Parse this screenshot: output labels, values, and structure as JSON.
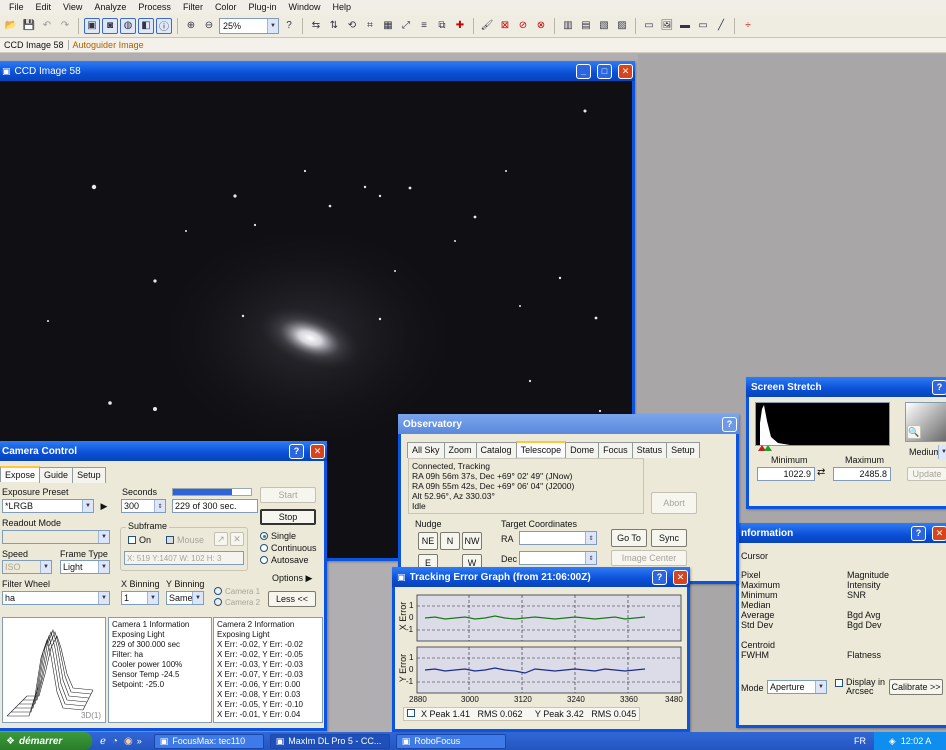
{
  "menu": [
    "File",
    "Edit",
    "View",
    "Analyze",
    "Process",
    "Filter",
    "Color",
    "Plug-in",
    "Window",
    "Help"
  ],
  "toolbar": {
    "zoom": "25%"
  },
  "doc_tabs": [
    "CCD Image 58",
    "Autoguider Image"
  ],
  "ccd": {
    "title": "CCD Image 58"
  },
  "stretch": {
    "title": "Screen Stretch",
    "min_label": "Minimum",
    "min_value": "1022.9",
    "max_label": "Maximum",
    "max_value": "2485.8",
    "mode_value": "Medium",
    "update_label": "Update"
  },
  "info": {
    "title": "nformation",
    "cursor": "Cursor",
    "left": [
      "Pixel",
      "Maximum",
      "Minimum",
      "Median",
      "Average",
      "Std Dev"
    ],
    "right": [
      "Magnitude",
      "Intensity",
      "SNR",
      "",
      "Bgd Avg",
      "Bgd Dev"
    ],
    "centroid": "Centroid",
    "fwhm": "FWHM",
    "flatness": "Flatness",
    "mode_label": "Mode",
    "mode_value": "Aperture",
    "display_arcsec": "Display in Arcsec",
    "calibrate": "Calibrate >>"
  },
  "obs": {
    "title": "Observatory",
    "tabs": [
      "All Sky",
      "Zoom",
      "Catalog",
      "Telescope",
      "Dome",
      "Focus",
      "Status",
      "Setup"
    ],
    "status": [
      "Connected, Tracking",
      "RA 09h 56m 37s, Dec +69° 02' 49\" (JNow)",
      "RA 09h 55m 42s, Dec +69° 06' 04\" (J2000)",
      "Alt 52.96°, Az 330.03°",
      "Idle"
    ],
    "abort": "Abort",
    "nudge_label": "Nudge",
    "nudge": [
      "NE",
      "N",
      "NW",
      "E",
      "W"
    ],
    "target_label": "Target Coordinates",
    "ra_label": "RA",
    "dec_label": "Dec",
    "goto": "Go To",
    "sync": "Sync",
    "image_center": "Image Center"
  },
  "cam": {
    "title": "Camera Control",
    "tabs": [
      "Expose",
      "Guide",
      "Setup"
    ],
    "preset_label": "Exposure Preset",
    "preset_value": "*LRGB",
    "seconds_label": "Seconds",
    "seconds_value": "300",
    "progress_text": "229 of 300 sec.",
    "progress_fraction": 0.76,
    "start": "Start",
    "stop": "Stop",
    "readout_label": "Readout Mode",
    "subframe_label": "Subframe",
    "on_label": "On",
    "mouse_label": "Mouse",
    "subframe_coords": "X: 519 Y:1407 W: 102 H: 3",
    "single": "Single",
    "continuous": "Continuous",
    "autosave": "Autosave",
    "speed_label": "Speed",
    "speed_value": "ISO",
    "frame_type_label": "Frame Type",
    "frame_type_value": "Light",
    "options": "Options",
    "filter_label": "Filter Wheel",
    "filter_value": "ha",
    "xbin_label": "X Binning",
    "xbin_value": "1",
    "ybin_label": "Y Binning",
    "ybin_value": "Same",
    "camera1": "Camera 1",
    "camera2": "Camera 2",
    "less": "Less <<",
    "plot_label": "3D(1)",
    "cam1_info": [
      "Camera 1 Information",
      "Exposing Light",
      "229 of 300.000 sec",
      "Filter: ha",
      "Cooler power 100%",
      "Sensor Temp -24.5",
      "Setpoint: -25.0"
    ],
    "cam2_info": [
      "Camera 2 Information",
      "Exposing Light",
      "X Err: -0.02, Y Err: -0.02",
      "X Err: -0.02, Y Err: -0.05",
      "X Err: -0.03, Y Err: -0.03",
      "X Err: -0.07, Y Err: -0.03",
      "X Err: -0.06, Y Err: 0.00",
      "X Err: -0.08, Y Err: 0.03",
      "X Err: -0.05, Y Err: -0.10",
      "X Err: -0.01, Y Err: 0.04"
    ]
  },
  "track": {
    "title": "Tracking Error Graph (from 21:06:00Z)",
    "xerror": "X Error",
    "yerror": "Y Error",
    "yticks": [
      "1",
      "0",
      "-1"
    ],
    "xticks": [
      "2880",
      "3000",
      "3120",
      "3240",
      "3360",
      "3480"
    ],
    "stats": "X Peak 1.41   RMS 0.062     Y Peak 3.42   RMS 0.045"
  },
  "taskbar": {
    "start": "démarrer",
    "tasks": [
      "FocusMax:   tec110",
      "MaxIm DL Pro 5 - CC...",
      "RoboFocus"
    ],
    "lang": "FR",
    "time": "12:02 A"
  }
}
